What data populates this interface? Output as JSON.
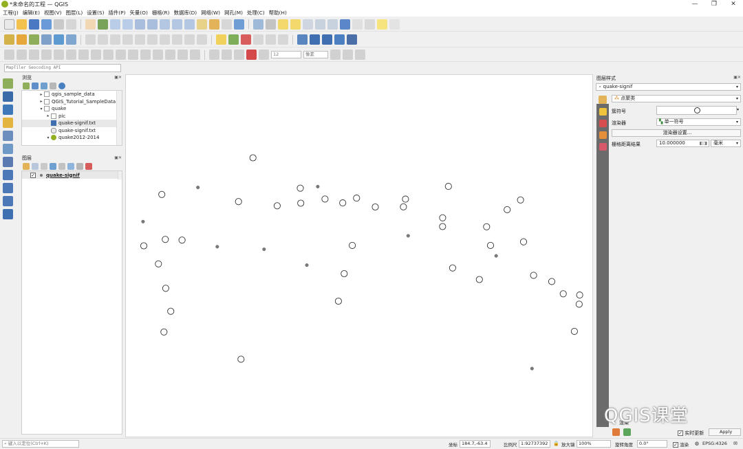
{
  "app": {
    "title": "*未命名的工程 — QGIS"
  },
  "window": {
    "minimize": "—",
    "maximize": "❐",
    "close": "✕"
  },
  "menu": [
    "工程(J)",
    "编辑(E)",
    "视图(V)",
    "图层(L)",
    "设置(S)",
    "插件(P)",
    "矢量(O)",
    "栅格(R)",
    "数据库(D)",
    "网络(W)",
    "网孔(M)",
    "处理(C)",
    "帮助(H)"
  ],
  "geocoder": {
    "placeholder": "MapTiler Geocoding API"
  },
  "toolbar3": {
    "size_value": "12",
    "unit": "像素"
  },
  "browser": {
    "title": "浏览",
    "items": [
      {
        "label": "qgis_sample_data",
        "indent": 1,
        "arrow": "▸"
      },
      {
        "label": "QGIS_Tutorial_SampleData",
        "indent": 1,
        "arrow": "▸"
      },
      {
        "label": "quake",
        "indent": 1,
        "arrow": "▾"
      },
      {
        "label": "pic",
        "indent": 2,
        "arrow": "▸"
      },
      {
        "label": "quake-signif.txt",
        "indent": 2,
        "arrow": ""
      },
      {
        "label": "quake-signif.txt",
        "indent": 2,
        "arrow": ""
      },
      {
        "label": "quake2012-2014",
        "indent": 2,
        "arrow": "▾"
      }
    ]
  },
  "layers": {
    "title": "图层",
    "items": [
      {
        "label": "quake-signif",
        "checked": "✓"
      }
    ]
  },
  "styling": {
    "title": "图层样式",
    "layer": "quake-signif",
    "renderer_type": "点聚类",
    "symbol_label": "簇符号",
    "renderer_label": "渲染器",
    "renderer_value": "单一符号",
    "settings_button": "渲染器设置...",
    "distance_label": "栅格距离结果",
    "distance_value": "10.000000",
    "unit": "毫米",
    "render_label": "渲染",
    "live_update": "实时更新",
    "apply": "Apply"
  },
  "status": {
    "search_placeholder": "键入以定位(Ctrl+K)",
    "coord_label": "坐标",
    "coord_value": "184.7,-63.4",
    "scale_label": "比例尺",
    "scale_value": "1:92737392",
    "magnifier_label": "放大镜",
    "magnifier_value": "100%",
    "rotation_label": "旋转角度",
    "rotation_value": "0.0°",
    "render_label": "渲染",
    "crs": "EPSG:4326"
  },
  "watermark": "QGIS课堂",
  "map_points": [
    {
      "x": 184.7,
      "y": 120.5,
      "kind": "cluster"
    },
    {
      "x": 52.2,
      "y": 173.8,
      "kind": "cluster"
    },
    {
      "x": 104.7,
      "y": 163.6,
      "kind": "point"
    },
    {
      "x": 24.9,
      "y": 213.3,
      "kind": "point"
    },
    {
      "x": 163.7,
      "y": 184.2,
      "kind": "cluster"
    },
    {
      "x": 219.9,
      "y": 190.3,
      "kind": "cluster"
    },
    {
      "x": 253.5,
      "y": 164.7,
      "kind": "cluster"
    },
    {
      "x": 254.2,
      "y": 186.5,
      "kind": "cluster"
    },
    {
      "x": 278.9,
      "y": 162.4,
      "kind": "point"
    },
    {
      "x": 289.4,
      "y": 180.4,
      "kind": "cluster"
    },
    {
      "x": 315.2,
      "y": 186.1,
      "kind": "cluster"
    },
    {
      "x": 335.3,
      "y": 179.1,
      "kind": "cluster"
    },
    {
      "x": 362.5,
      "y": 192.0,
      "kind": "cluster"
    },
    {
      "x": 403.4,
      "y": 191.8,
      "kind": "cluster"
    },
    {
      "x": 406.4,
      "y": 180.6,
      "kind": "cluster"
    },
    {
      "x": 468.8,
      "y": 162.1,
      "kind": "cluster"
    },
    {
      "x": 460.4,
      "y": 207.8,
      "kind": "cluster"
    },
    {
      "x": 460.3,
      "y": 220.5,
      "kind": "cluster"
    },
    {
      "x": 410.3,
      "y": 233.9,
      "kind": "point"
    },
    {
      "x": 26.0,
      "y": 248.5,
      "kind": "cluster"
    },
    {
      "x": 57.3,
      "y": 239.2,
      "kind": "cluster"
    },
    {
      "x": 81.6,
      "y": 240.2,
      "kind": "cluster"
    },
    {
      "x": 132.8,
      "y": 249.8,
      "kind": "point"
    },
    {
      "x": 200.8,
      "y": 253.5,
      "kind": "point"
    },
    {
      "x": 329.1,
      "y": 247.9,
      "kind": "cluster"
    },
    {
      "x": 47.3,
      "y": 274.8,
      "kind": "cluster"
    },
    {
      "x": 263.0,
      "y": 276.6,
      "kind": "point"
    },
    {
      "x": 317.3,
      "y": 289.0,
      "kind": "cluster"
    },
    {
      "x": 474.9,
      "y": 280.7,
      "kind": "cluster"
    },
    {
      "x": 57.9,
      "y": 310.3,
      "kind": "cluster"
    },
    {
      "x": 65.2,
      "y": 343.7,
      "kind": "cluster"
    },
    {
      "x": 308.9,
      "y": 329.0,
      "kind": "cluster"
    },
    {
      "x": 55.3,
      "y": 373.8,
      "kind": "cluster"
    },
    {
      "x": 167.3,
      "y": 413.4,
      "kind": "cluster"
    },
    {
      "x": 524.3,
      "y": 220.8,
      "kind": "cluster"
    },
    {
      "x": 554.2,
      "y": 195.9,
      "kind": "cluster"
    },
    {
      "x": 573.6,
      "y": 181.8,
      "kind": "cluster"
    },
    {
      "x": 530.0,
      "y": 247.9,
      "kind": "cluster"
    },
    {
      "x": 538.2,
      "y": 263.1,
      "kind": "point"
    },
    {
      "x": 578.0,
      "y": 242.7,
      "kind": "cluster"
    },
    {
      "x": 513.8,
      "y": 297.5,
      "kind": "cluster"
    },
    {
      "x": 592.6,
      "y": 291.4,
      "kind": "cluster"
    },
    {
      "x": 619.0,
      "y": 300.4,
      "kind": "cluster"
    },
    {
      "x": 635.7,
      "y": 318.3,
      "kind": "cluster"
    },
    {
      "x": 659.6,
      "y": 320.1,
      "kind": "cluster"
    },
    {
      "x": 658.8,
      "y": 333.4,
      "kind": "cluster"
    },
    {
      "x": 651.9,
      "y": 372.9,
      "kind": "cluster"
    },
    {
      "x": 590.3,
      "y": 427.0,
      "kind": "point"
    }
  ]
}
